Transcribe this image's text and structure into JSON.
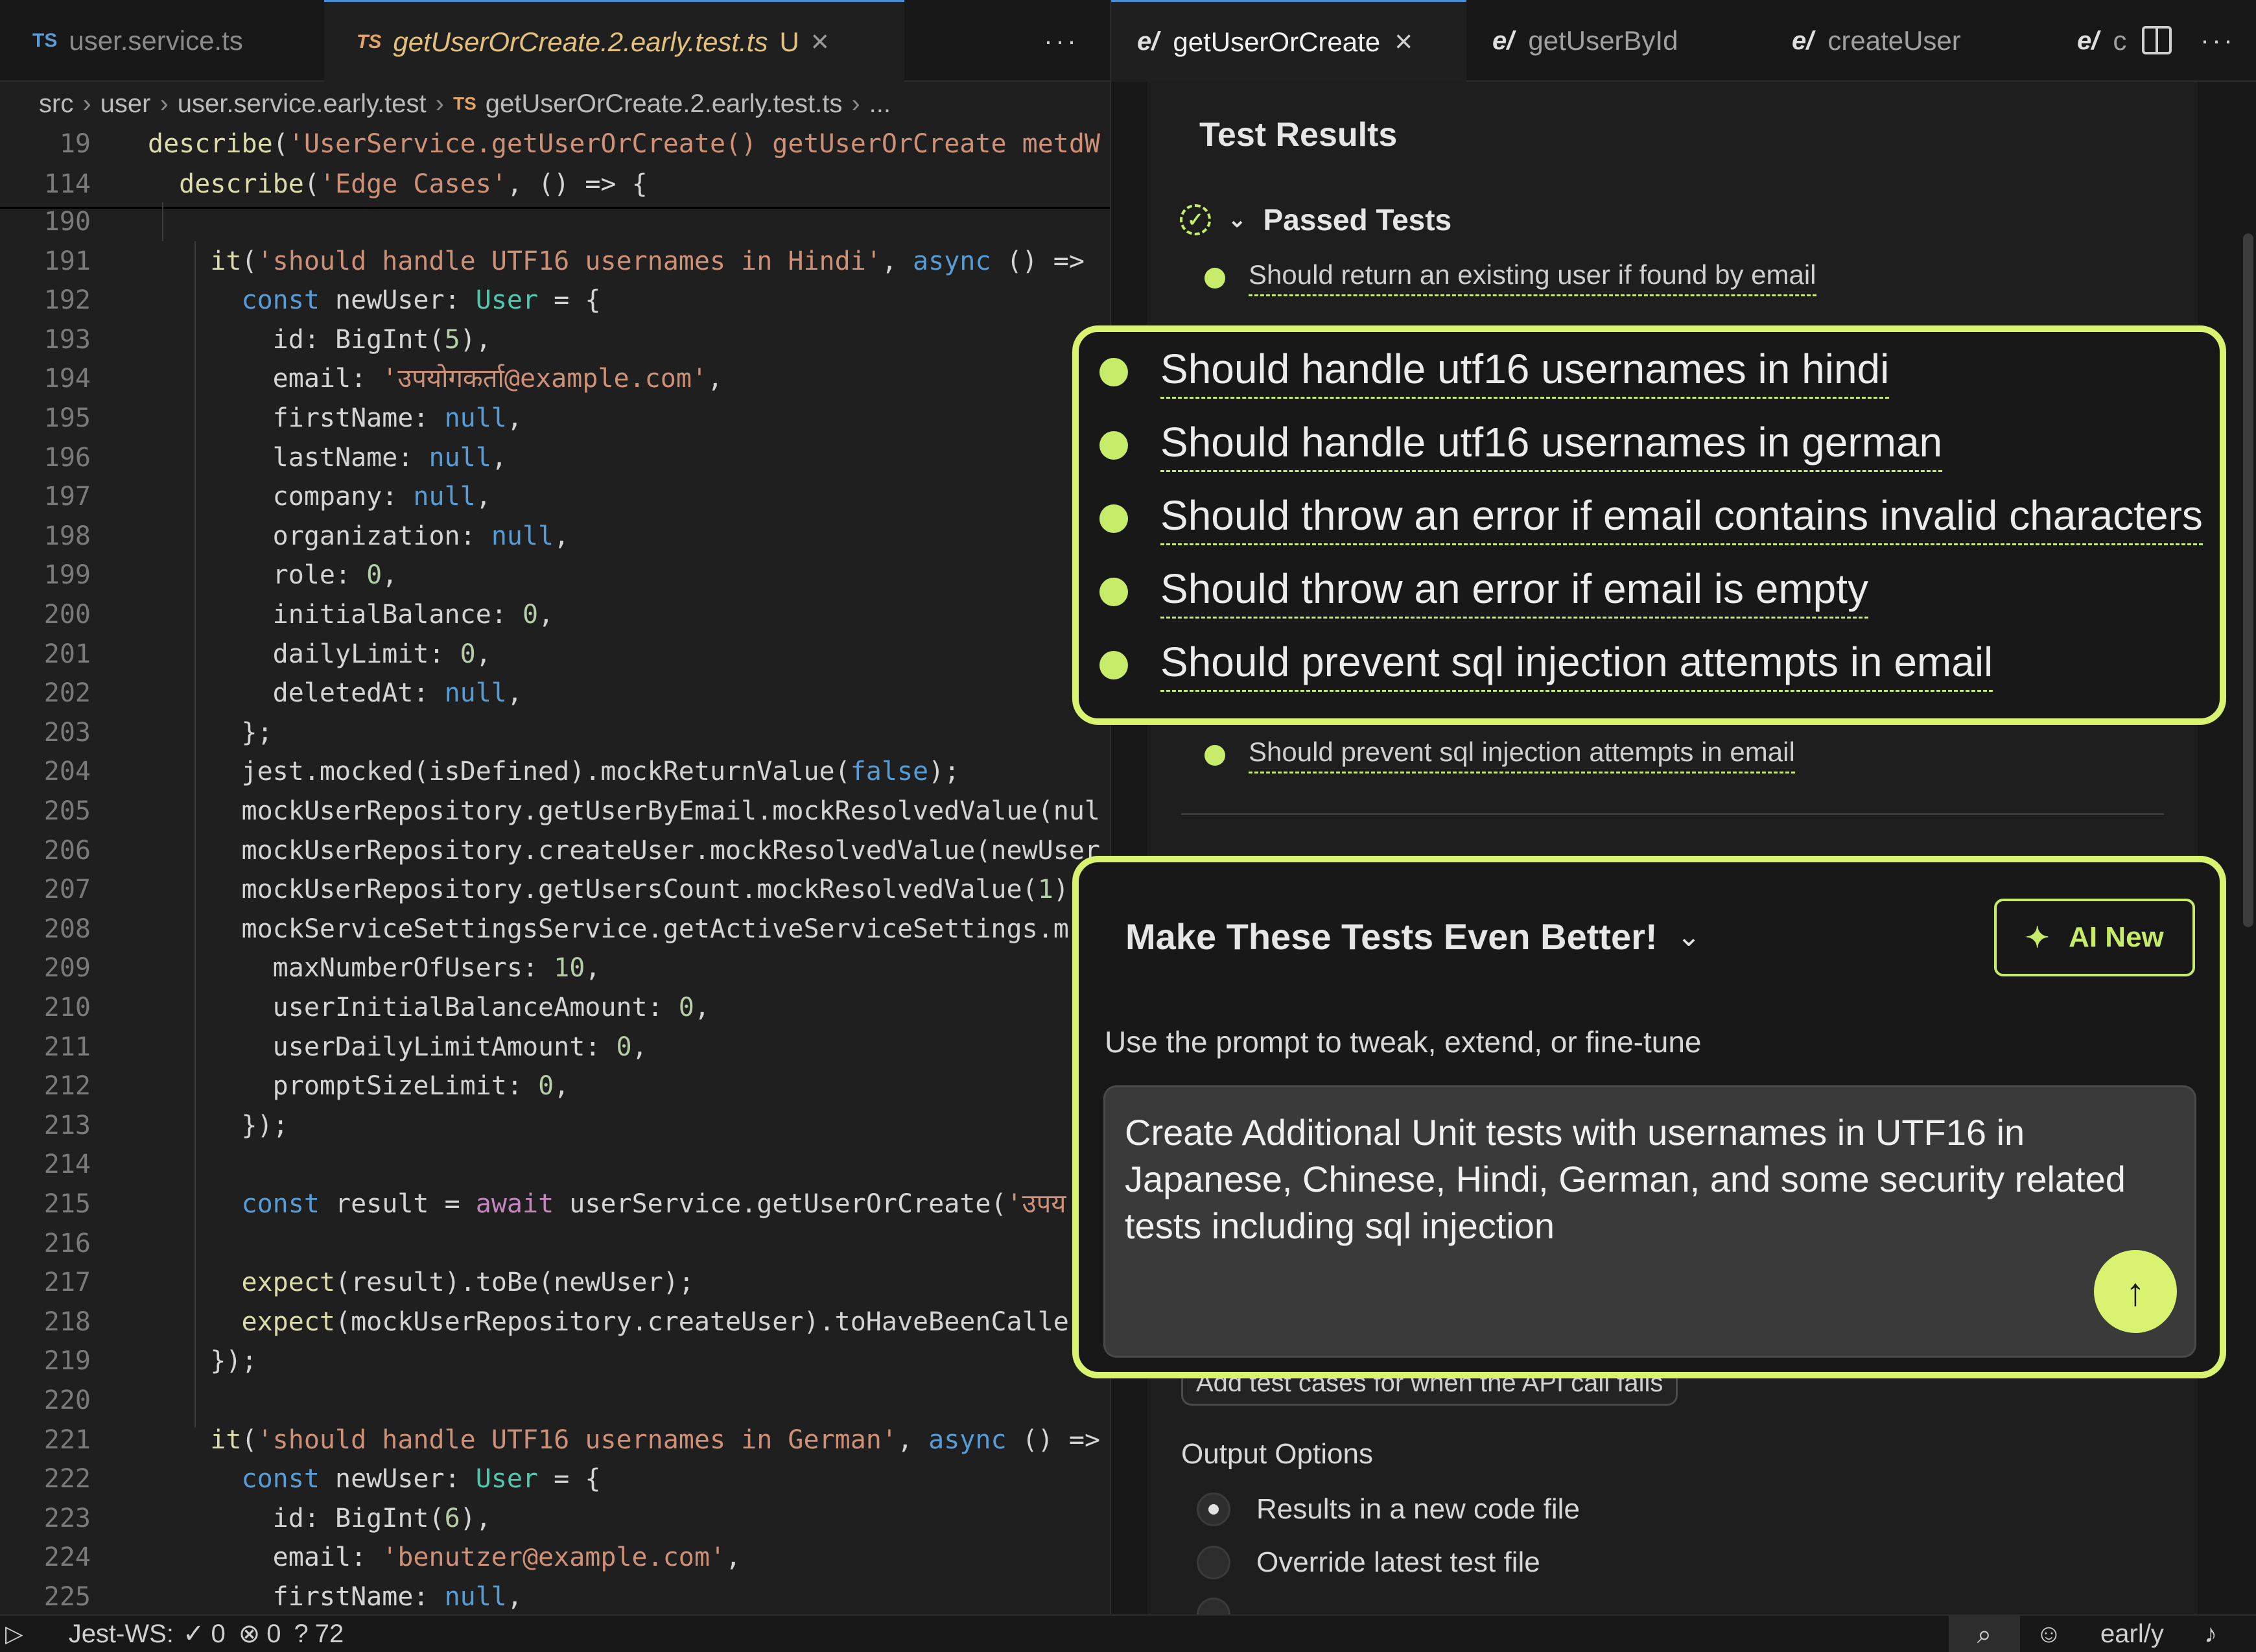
{
  "editor_tabs": [
    {
      "lang": "TS",
      "label": "user.service.ts",
      "status": ""
    },
    {
      "lang": "TS",
      "label": "getUserOrCreate.2.early.test.ts",
      "status": "U"
    }
  ],
  "editor_more": "···",
  "breadcrumb": [
    "src",
    "user",
    "user.service.early.test",
    "getUserOrCreate.2.early.test.ts",
    "..."
  ],
  "sticky_lines": [
    {
      "num": "19",
      "text": "describe('UserService.getUserOrCreate() getUserOrCreate metdW"
    },
    {
      "num": "114",
      "text": "  describe('Edge Cases', () => {"
    }
  ],
  "code_lines": [
    {
      "num": "190",
      "text": ""
    },
    {
      "num": "191",
      "text": "    it('should handle UTF16 usernames in Hindi', async () =>"
    },
    {
      "num": "192",
      "text": "      const newUser: User = {"
    },
    {
      "num": "193",
      "text": "        id: BigInt(5),"
    },
    {
      "num": "194",
      "text": "        email: 'उपयोगकर्ता@example.com',"
    },
    {
      "num": "195",
      "text": "        firstName: null,"
    },
    {
      "num": "196",
      "text": "        lastName: null,"
    },
    {
      "num": "197",
      "text": "        company: null,"
    },
    {
      "num": "198",
      "text": "        organization: null,"
    },
    {
      "num": "199",
      "text": "        role: 0,"
    },
    {
      "num": "200",
      "text": "        initialBalance: 0,"
    },
    {
      "num": "201",
      "text": "        dailyLimit: 0,"
    },
    {
      "num": "202",
      "text": "        deletedAt: null,"
    },
    {
      "num": "203",
      "text": "      };"
    },
    {
      "num": "204",
      "text": "      jest.mocked(isDefined).mockReturnValue(false);"
    },
    {
      "num": "205",
      "text": "      mockUserRepository.getUserByEmail.mockResolvedValue(nul"
    },
    {
      "num": "206",
      "text": "      mockUserRepository.createUser.mockResolvedValue(newUser"
    },
    {
      "num": "207",
      "text": "      mockUserRepository.getUsersCount.mockResolvedValue(1)"
    },
    {
      "num": "208",
      "text": "      mockServiceSettingsService.getActiveServiceSettings.m"
    },
    {
      "num": "209",
      "text": "        maxNumberOfUsers: 10,"
    },
    {
      "num": "210",
      "text": "        userInitialBalanceAmount: 0,"
    },
    {
      "num": "211",
      "text": "        userDailyLimitAmount: 0,"
    },
    {
      "num": "212",
      "text": "        promptSizeLimit: 0,"
    },
    {
      "num": "213",
      "text": "      });"
    },
    {
      "num": "214",
      "text": ""
    },
    {
      "num": "215",
      "text": "      const result = await userService.getUserOrCreate('उपय"
    },
    {
      "num": "216",
      "text": ""
    },
    {
      "num": "217",
      "text": "      expect(result).toBe(newUser);"
    },
    {
      "num": "218",
      "text": "      expect(mockUserRepository.createUser).toHaveBeenCalle"
    },
    {
      "num": "219",
      "text": "    });"
    },
    {
      "num": "220",
      "text": ""
    },
    {
      "num": "221",
      "text": "    it('should handle UTF16 usernames in German', async () =>"
    },
    {
      "num": "222",
      "text": "      const newUser: User = {"
    },
    {
      "num": "223",
      "text": "        id: BigInt(6),"
    },
    {
      "num": "224",
      "text": "        email: 'benutzer@example.com',"
    },
    {
      "num": "225",
      "text": "        firstName: null,"
    }
  ],
  "right_tabs": [
    {
      "icon": "e/",
      "label": "getUserOrCreate",
      "close": "×"
    },
    {
      "icon": "e/",
      "label": "getUserById"
    },
    {
      "icon": "e/",
      "label": "createUser"
    },
    {
      "icon": "e/",
      "label": "c"
    }
  ],
  "right_more": "···",
  "results": {
    "title": "Test Results",
    "passed_label": "Passed Tests",
    "small_tests": [
      "Should return an existing user if found by email",
      "Should prevent sql injection attempts in email"
    ],
    "highlight_tests": [
      "Should handle utf16 usernames in hindi",
      "Should handle utf16 usernames in german",
      "Should throw an error if email contains invalid characters",
      "Should throw an error if email is empty",
      "Should prevent sql injection attempts in email"
    ]
  },
  "improve": {
    "title": "Make These Tests Even Better!",
    "ai_button": "AI New",
    "subtitle": "Use the prompt to tweak, extend, or fine-tune",
    "prompt": "Create Additional Unit tests with usernames in UTF16 in Japanese, Chinese, Hindi, German, and some security related tests including sql injection",
    "suggestion_chip": "Add test cases for when the API call fails"
  },
  "output": {
    "label": "Output Options",
    "options": [
      {
        "label": "Results in a new code file",
        "selected": true
      },
      {
        "label": "Override latest test file",
        "selected": false
      }
    ]
  },
  "statusbar": {
    "runner": "Jest-WS:",
    "passed": "0",
    "failed": "0",
    "unknown": "72",
    "right_label": "earl/y"
  },
  "colors": {
    "accent": "#d9f26f",
    "pass_dot": "#c6ec6a",
    "editor_bg": "#1f1f1f"
  }
}
